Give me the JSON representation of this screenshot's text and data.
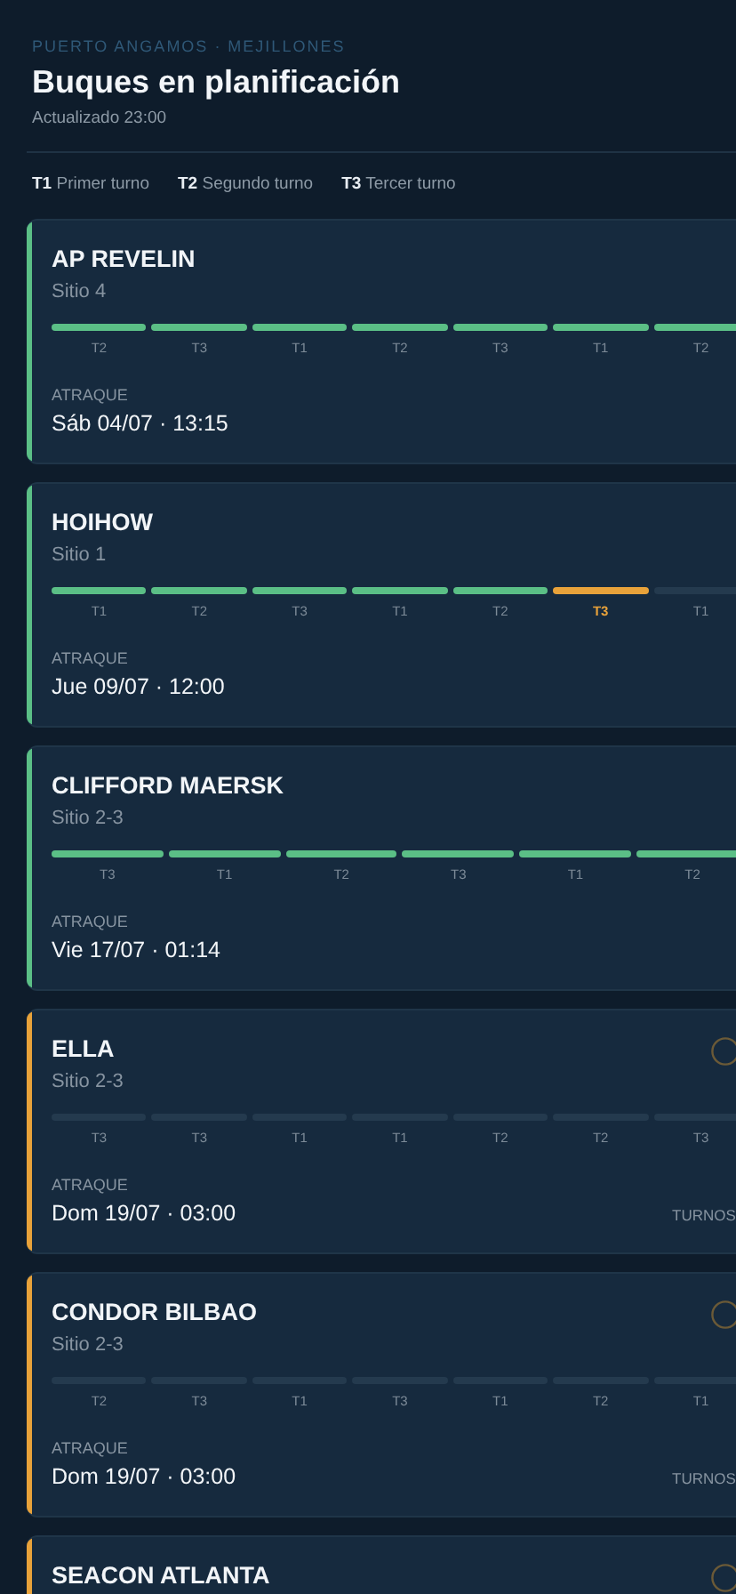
{
  "header": {
    "port": "PUERTO ANGAMOS · MEJILLONES",
    "title": "Buques en planificación",
    "updated": "Actualizado 23:00"
  },
  "legend": [
    {
      "code": "T1",
      "label": "Primer turno"
    },
    {
      "code": "T2",
      "label": "Segundo turno"
    },
    {
      "code": "T3",
      "label": "Tercer turno"
    }
  ],
  "ships": [
    {
      "name": "AP REVELIN",
      "berth": "Sitio 4",
      "color": "#5bbf86",
      "flagged": false,
      "shifts": [
        {
          "label": "T2",
          "done": true,
          "current": false
        },
        {
          "label": "T3",
          "done": true,
          "current": false
        },
        {
          "label": "T1",
          "done": true,
          "current": false
        },
        {
          "label": "T2",
          "done": true,
          "current": false
        },
        {
          "label": "T3",
          "done": true,
          "current": false
        },
        {
          "label": "T1",
          "done": true,
          "current": false
        },
        {
          "label": "T2",
          "done": true,
          "current": false
        }
      ],
      "berthing_label": "ATRAQUE",
      "berthing": "Sáb 04/07 · 13:15"
    },
    {
      "name": "HOIHOW",
      "berth": "Sitio 1",
      "color": "#5bbf86",
      "flagged": false,
      "shifts": [
        {
          "label": "T1",
          "done": true,
          "current": false
        },
        {
          "label": "T2",
          "done": true,
          "current": false
        },
        {
          "label": "T3",
          "done": true,
          "current": false
        },
        {
          "label": "T1",
          "done": true,
          "current": false
        },
        {
          "label": "T2",
          "done": true,
          "current": false
        },
        {
          "label": "T3",
          "done": false,
          "current": true
        },
        {
          "label": "T1",
          "done": false,
          "current": false
        }
      ],
      "berthing_label": "ATRAQUE",
      "berthing": "Jue 09/07 · 12:00"
    },
    {
      "name": "CLIFFORD MAERSK",
      "berth": "Sitio 2-3",
      "color": "#5bbf86",
      "flagged": false,
      "shifts": [
        {
          "label": "T3",
          "done": true,
          "current": false
        },
        {
          "label": "T1",
          "done": true,
          "current": false
        },
        {
          "label": "T2",
          "done": true,
          "current": false
        },
        {
          "label": "T3",
          "done": true,
          "current": false
        },
        {
          "label": "T1",
          "done": true,
          "current": false
        },
        {
          "label": "T2",
          "done": true,
          "current": false
        }
      ],
      "berthing_label": "ATRAQUE",
      "berthing": "Vie 17/07 · 01:14"
    },
    {
      "name": "ELLA",
      "berth": "Sitio 2-3",
      "color": "#e8a23a",
      "flagged": true,
      "shifts": [
        {
          "label": "T3",
          "done": false,
          "current": false
        },
        {
          "label": "T3",
          "done": false,
          "current": false
        },
        {
          "label": "T1",
          "done": false,
          "current": false
        },
        {
          "label": "T1",
          "done": false,
          "current": false
        },
        {
          "label": "T2",
          "done": false,
          "current": false
        },
        {
          "label": "T2",
          "done": false,
          "current": false
        },
        {
          "label": "T3",
          "done": false,
          "current": false
        }
      ],
      "berthing_label": "ATRAQUE",
      "berthing": "Dom 19/07 · 03:00",
      "side_text": "TURNOS"
    },
    {
      "name": "CONDOR BILBAO",
      "berth": "Sitio 2-3",
      "color": "#e8a23a",
      "flagged": true,
      "shifts": [
        {
          "label": "T2",
          "done": false,
          "current": false
        },
        {
          "label": "T3",
          "done": false,
          "current": false
        },
        {
          "label": "T1",
          "done": false,
          "current": false
        },
        {
          "label": "T3",
          "done": false,
          "current": false
        },
        {
          "label": "T1",
          "done": false,
          "current": false
        },
        {
          "label": "T2",
          "done": false,
          "current": false
        },
        {
          "label": "T1",
          "done": false,
          "current": false
        }
      ],
      "berthing_label": "ATRAQUE",
      "berthing": "Dom 19/07 · 03:00",
      "side_text": "TURNOS"
    },
    {
      "name": "SEACON ATLANTA",
      "color": "#e8a23a",
      "flagged": true
    }
  ]
}
